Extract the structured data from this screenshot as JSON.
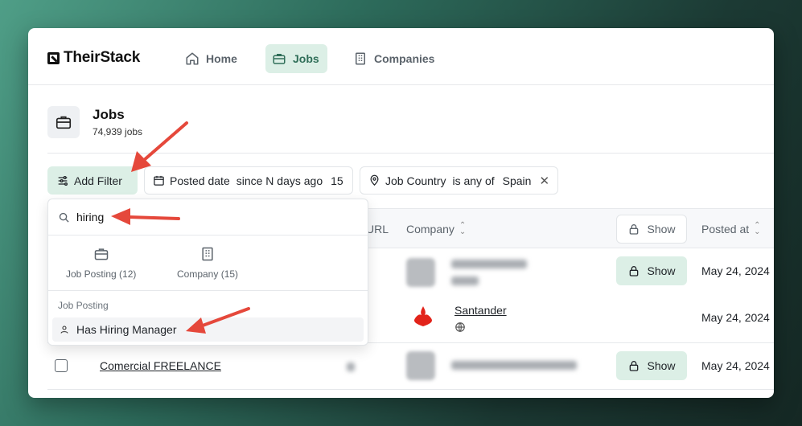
{
  "app": {
    "logo_text": "TheirStack"
  },
  "nav": {
    "items": [
      {
        "label": "Home",
        "icon": "home-icon"
      },
      {
        "label": "Jobs",
        "icon": "briefcase-icon",
        "active": true
      },
      {
        "label": "Companies",
        "icon": "building-icon"
      }
    ]
  },
  "page": {
    "title": "Jobs",
    "subtitle": "74,939 jobs"
  },
  "filters": {
    "add_label": "Add Filter",
    "posted": {
      "field": "Posted date",
      "operator": "since N days ago",
      "value": "15"
    },
    "country": {
      "field": "Job Country",
      "operator": "is any of",
      "value": "Spain"
    }
  },
  "dropdown": {
    "search_value": "hiring",
    "categories": [
      {
        "label": "Job Posting (12)",
        "icon": "briefcase-icon"
      },
      {
        "label": "Company (15)",
        "icon": "building-icon"
      }
    ],
    "group_label": "Job Posting",
    "items": [
      {
        "label": "Has Hiring Manager",
        "icon": "person-icon"
      }
    ]
  },
  "table": {
    "headers": {
      "url": "URL",
      "company": "Company",
      "show": "Show",
      "posted_at": "Posted at"
    },
    "rows": [
      {
        "title": "",
        "company": "",
        "show_label": "Show",
        "posted_at": "May 24, 2024"
      },
      {
        "title": "",
        "company": "Santander",
        "show_label": "",
        "posted_at": "May 24, 2024"
      },
      {
        "title": "Comercial FREELANCE",
        "company": "",
        "show_label": "Show",
        "posted_at": "May 24, 2024"
      }
    ]
  },
  "colors": {
    "accent_bg": "#dcefe6",
    "accent_text": "#2f6e58",
    "arrow": "#e5483b",
    "santander": "#e2231a"
  }
}
